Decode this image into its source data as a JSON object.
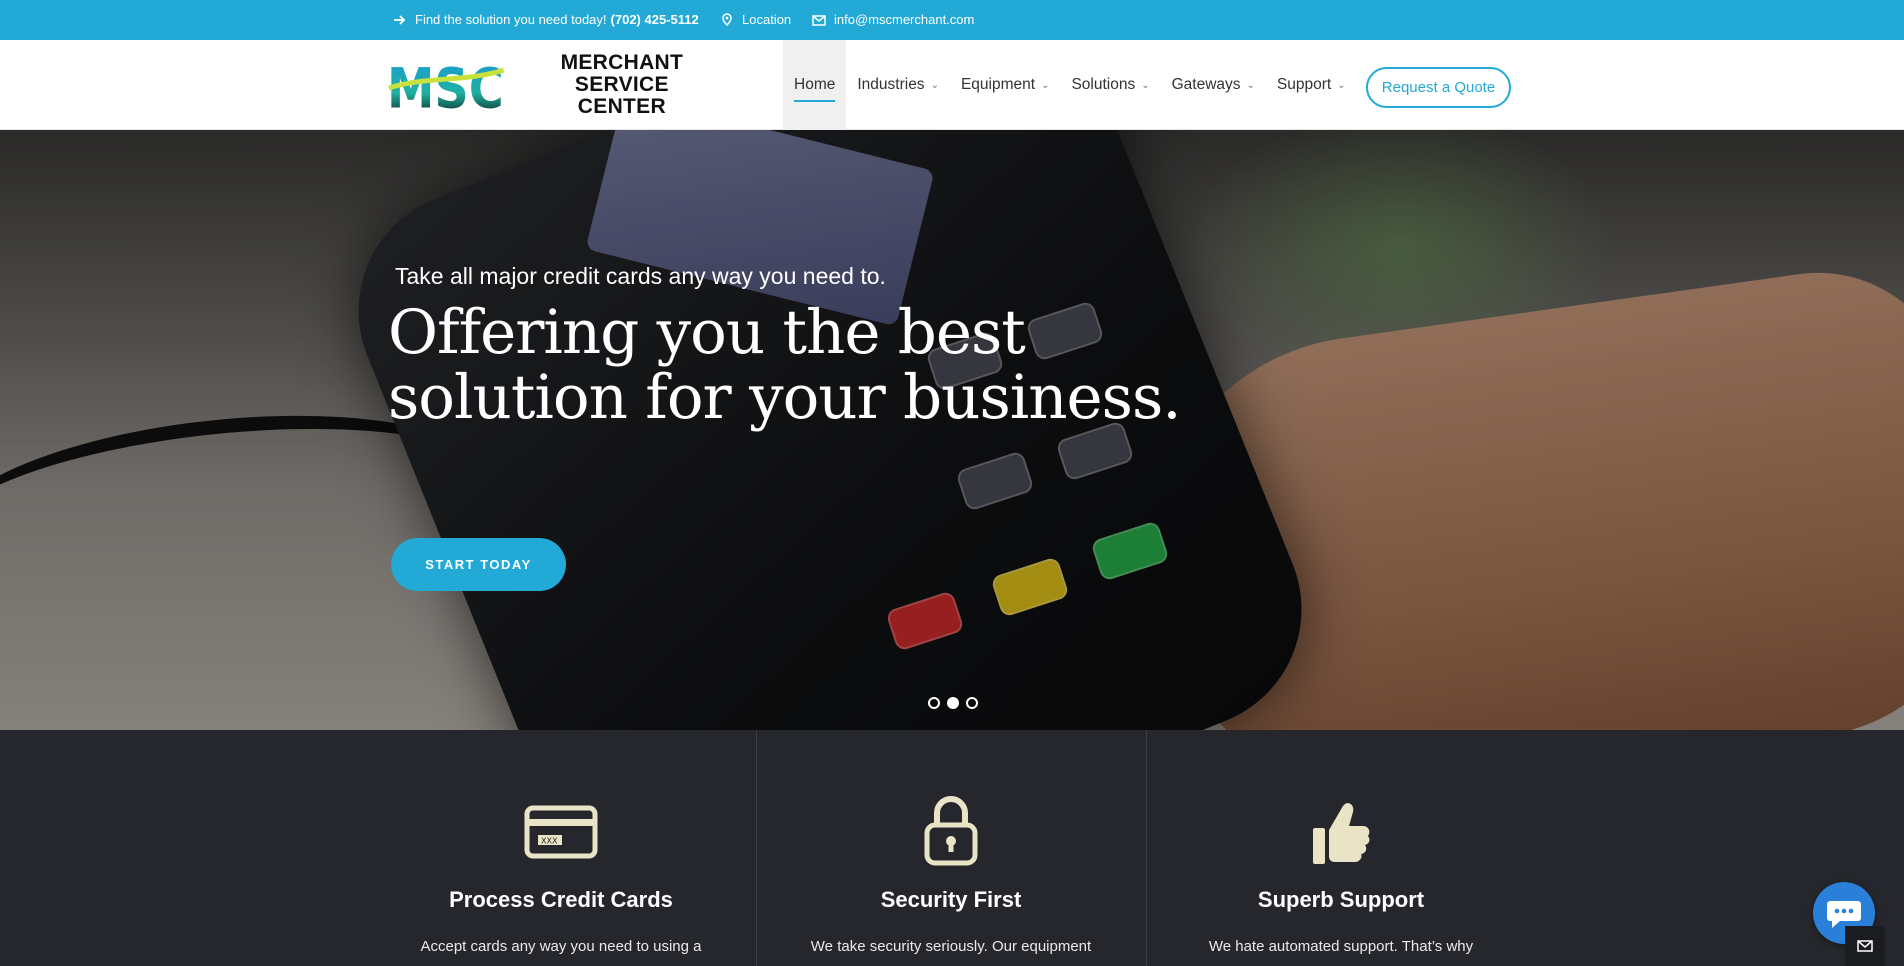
{
  "topbar": {
    "phone_prefix": "Find the solution you need today!",
    "phone_number": "(702) 425-5112",
    "location_label": "Location",
    "email": "info@mscmerchant.com",
    "icons": [
      "arrow-right-icon",
      "map-pin-icon",
      "mail-icon"
    ]
  },
  "header": {
    "logo_letters": "MSC",
    "logo_line1": "MERCHANT SERVICE",
    "logo_line2": "CENTER",
    "nav": [
      {
        "label": "Home",
        "active": true
      },
      {
        "label": "Industries",
        "dropdown": true
      },
      {
        "label": "Equipment",
        "dropdown": true
      },
      {
        "label": "Solutions",
        "dropdown": true
      },
      {
        "label": "Gateways",
        "dropdown": true
      },
      {
        "label": "Support",
        "dropdown": true
      }
    ],
    "quote_button": "Request a Quote"
  },
  "hero": {
    "subtitle": "Take all major credit cards any way you need to.",
    "title_line1": "Offering you the best",
    "title_line2": "solution for your business.",
    "cta": "START TODAY",
    "slide_count": 3,
    "active_slide": 2
  },
  "features": [
    {
      "icon": "credit-card-icon",
      "title": "Process Credit Cards",
      "text": "Accept cards any way you need to using a"
    },
    {
      "icon": "lock-icon",
      "title": "Security First",
      "text": "We take security seriously. Our equipment"
    },
    {
      "icon": "thumbs-up-icon",
      "title": "Superb Support",
      "text": "We hate automated support. That’s why"
    }
  ],
  "colors": {
    "accent": "#22a9d6",
    "dark_section": "#25272c",
    "icon_cream": "#e9e4c6",
    "chat_blue": "#2a7fd9"
  }
}
